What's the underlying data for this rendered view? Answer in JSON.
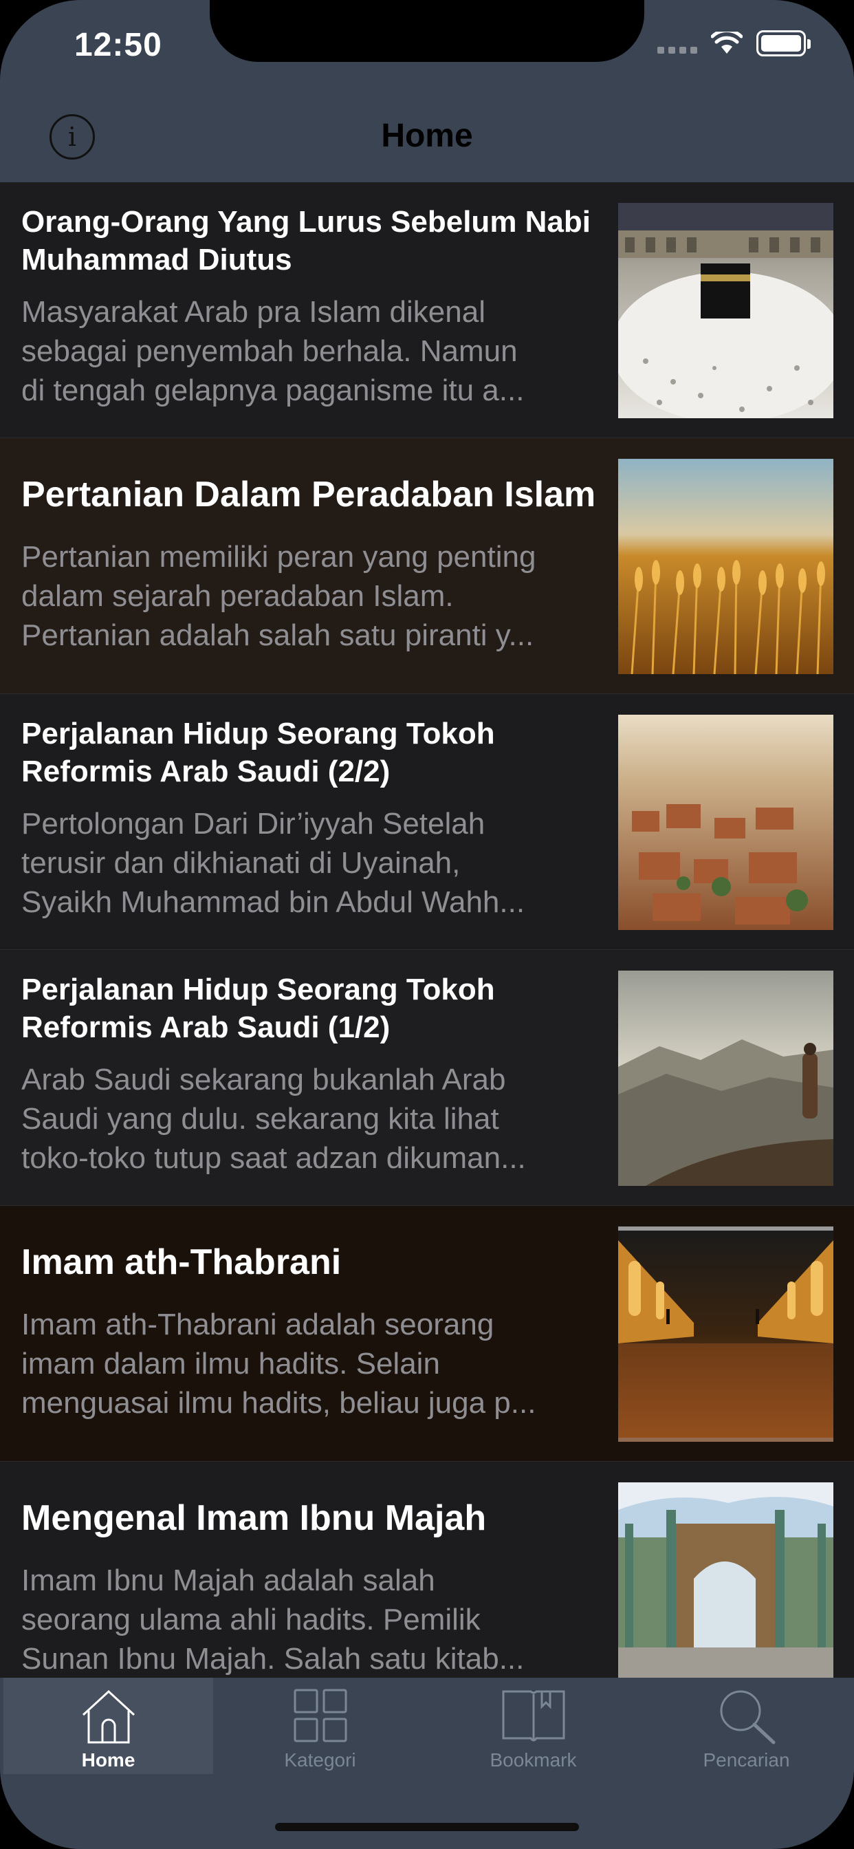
{
  "status_bar": {
    "time": "12:50"
  },
  "nav": {
    "title": "Home",
    "info_icon": "info-icon"
  },
  "articles": [
    {
      "title": "Orang-Orang Yang Lurus Sebelum Nabi Muhammad Diutus",
      "desc_lines": [
        "Masyarakat Arab pra Islam dikenal",
        "sebagai penyembah berhala. Namun",
        "di tengah gelapnya paganisme itu a..."
      ],
      "image": "kaaba-crowd-image",
      "bg": "#1c1c1e"
    },
    {
      "title": "Pertanian Dalam Peradaban Islam",
      "desc_lines": [
        "Pertanian memiliki peran yang penting",
        "dalam sejarah peradaban Islam.",
        "Pertanian adalah salah satu piranti y..."
      ],
      "image": "wheat-field-image",
      "bg": "#221b16"
    },
    {
      "title": "Perjalanan Hidup Seorang Tokoh Reformis Arab Saudi (2/2)",
      "desc_lines": [
        "Pertolongan Dari Dir’iyyah Setelah",
        "terusir dan dikhianati di Uyainah,",
        "Syaikh Muhammad bin Abdul Wahh..."
      ],
      "image": "desert-ruins-image",
      "bg": "#1c1c1e"
    },
    {
      "title": "Perjalanan Hidup Seorang Tokoh Reformis Arab Saudi (1/2)",
      "desc_lines": [
        "Arab Saudi sekarang bukanlah Arab",
        "Saudi yang dulu. sekarang kita lihat",
        "toko-toko tutup saat adzan dikuman..."
      ],
      "image": "mountain-view-image",
      "bg": "#1e1e20"
    },
    {
      "title": "Imam ath-Thabrani",
      "desc_lines": [
        "Imam ath-Thabrani adalah seorang",
        "imam dalam ilmu hadits. Selain",
        "menguasai ilmu hadits, beliau juga p..."
      ],
      "image": "arched-corridor-image",
      "bg": "#1a110b"
    },
    {
      "title": "Mengenal Imam Ibnu Majah",
      "desc_lines": [
        "Imam Ibnu Majah adalah salah",
        "seorang ulama ahli hadits. Pemilik",
        "Sunan Ibnu Majah. Salah satu kitab..."
      ],
      "image": "tiled-gate-image",
      "bg": "#1c1c1e"
    }
  ],
  "tabbar": {
    "tabs": [
      {
        "label": "Home",
        "icon": "home-icon",
        "active": true
      },
      {
        "label": "Kategori",
        "icon": "grid-icon",
        "active": false
      },
      {
        "label": "Bookmark",
        "icon": "book-icon",
        "active": false
      },
      {
        "label": "Pencarian",
        "icon": "search-icon",
        "active": false
      }
    ]
  },
  "colors": {
    "header_bg": "#3a4452",
    "list_bg": "#1c1c1e",
    "title_text": "#ffffff",
    "desc_text": "#8e8e93",
    "tab_inactive": "#7b8796"
  }
}
